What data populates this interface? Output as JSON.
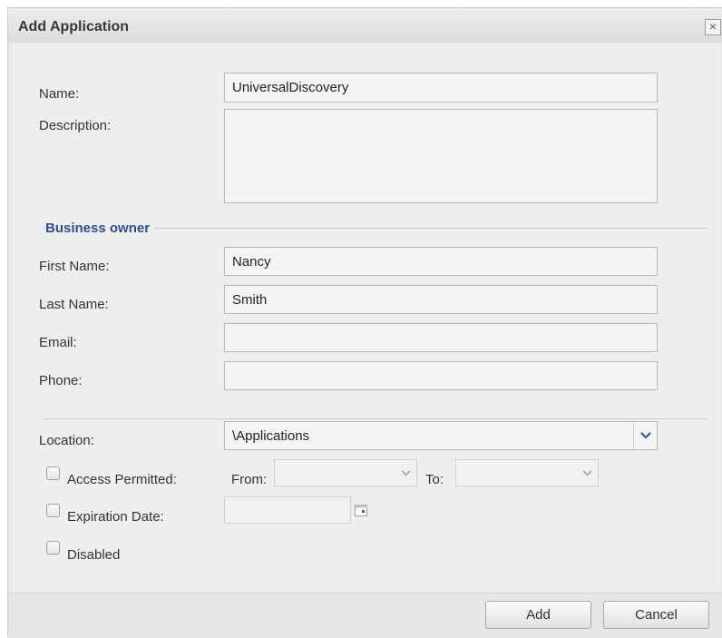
{
  "dialog": {
    "title": "Add Application",
    "close_symbol": "×"
  },
  "form": {
    "name_label": "Name:",
    "name_value": "UniversalDiscovery",
    "description_label": "Description:",
    "description_value": "",
    "business_owner": {
      "section_title": "Business owner",
      "first_name_label": "First Name:",
      "first_name_value": "Nancy",
      "last_name_label": "Last Name:",
      "last_name_value": "Smith",
      "email_label": "Email:",
      "email_value": "",
      "phone_label": "Phone:",
      "phone_value": ""
    },
    "location_label": "Location:",
    "location_value": "\\Applications",
    "access_permitted": {
      "label": "Access Permitted:",
      "checked": false,
      "from_label": "From:",
      "from_value": "",
      "to_label": "To:",
      "to_value": ""
    },
    "expiration": {
      "label": "Expiration Date:",
      "checked": false,
      "value": ""
    },
    "disabled": {
      "label": "Disabled",
      "checked": false
    }
  },
  "buttons": {
    "add_label": "Add",
    "cancel_label": "Cancel"
  },
  "icons": {
    "close": "close-icon",
    "dropdown": "chevron-down-icon",
    "calendar": "calendar-icon"
  },
  "colors": {
    "section_title": "#2c4f8f",
    "dropdown_arrow_active": "#2f5d9b",
    "dropdown_arrow_disabled": "#9aaac0"
  }
}
